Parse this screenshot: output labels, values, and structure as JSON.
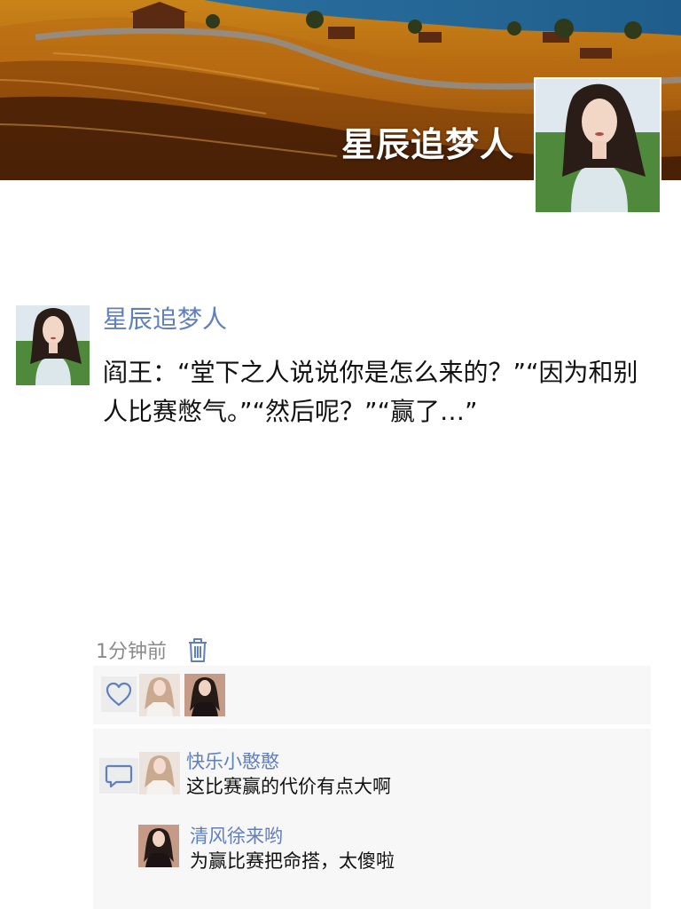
{
  "profile": {
    "name": "星辰追梦人",
    "cover": "landscape-cover-image",
    "avatar": "portrait-avatar"
  },
  "post": {
    "author": "星辰追梦人",
    "text": "阎王：“堂下之人说说你是怎么来的？”“因为和别人比赛憋气。”“然后呢？”“赢了…”",
    "time": "1分钟前",
    "delete_icon": "trash-icon"
  },
  "likes": {
    "icon": "heart-icon",
    "avatars": [
      "liker-avatar-1",
      "liker-avatar-2"
    ]
  },
  "comments": {
    "icon": "comment-icon",
    "items": [
      {
        "name": "快乐小憨憨",
        "text": "这比赛赢的代价有点大啊"
      },
      {
        "name": "清风徐来哟",
        "text": "为赢比赛把命搭，太傻啦"
      }
    ]
  },
  "colors": {
    "link_blue": "#5f7fbf",
    "panel_bg": "#f7f7f7",
    "time_gray": "#8a8a8a"
  }
}
